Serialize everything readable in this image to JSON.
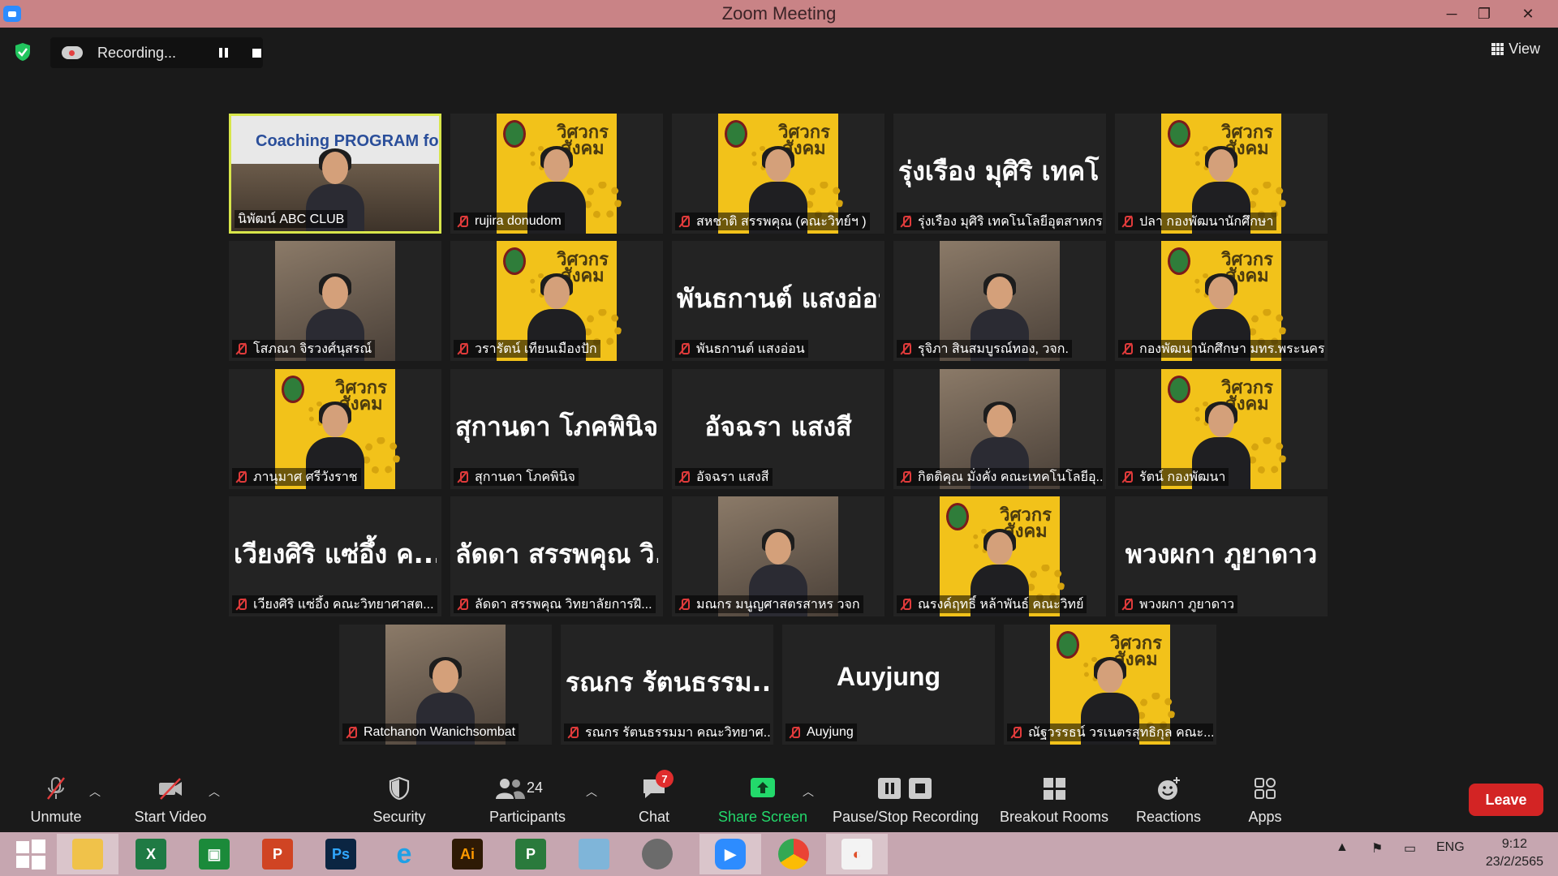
{
  "window": {
    "title": "Zoom Meeting",
    "minimize": "─",
    "restore": "❐",
    "close": "✕"
  },
  "topbar": {
    "recording_label": "Recording...",
    "view_label": "View"
  },
  "tiles": [
    {
      "label": "นิพัฒน์ ABC CLUB",
      "type": "photo",
      "overlay": "Coaching PROGRAM for ..."
    },
    {
      "label": "rujira donudom",
      "type": "poster"
    },
    {
      "label": "สหชาติ สรรพคุณ (คณะวิทย์ฯ )",
      "type": "poster"
    },
    {
      "label": "รุ่งเรือง มุศิริ เทคโนโลยีอุตสาหกร...",
      "type": "name",
      "big": "รุ่งเรือง มุศิริ เทคโ..."
    },
    {
      "label": "ปลา กองพัฒนานักศึกษา",
      "type": "poster"
    },
    {
      "label": "โสภณา จิรวงศ์นุสรณ์",
      "type": "photo"
    },
    {
      "label": "วรารัตน์ เทียนเมืองปัก",
      "type": "poster"
    },
    {
      "label": "พันธกานต์ แสงอ่อน",
      "type": "name",
      "big": "พันธกานต์ แสงอ่อน"
    },
    {
      "label": "รุจิภา สินสมบูรณ์ทอง, วจก.",
      "type": "photo"
    },
    {
      "label": "กองพัฒนานักศึกษา มทร.พระนคร",
      "type": "poster"
    },
    {
      "label": "ภานุมาศ ศรีวังราช",
      "type": "poster"
    },
    {
      "label": "สุกานดา โภคพินิจ",
      "type": "name",
      "big": "สุกานดา โภคพินิจ"
    },
    {
      "label": "อัจฉรา แสงสี",
      "type": "name",
      "big": "อัจฉรา แสงสี"
    },
    {
      "label": "กิตติคุณ มั่งคั่ง คณะเทคโนโลยีอุ...",
      "type": "photo"
    },
    {
      "label": "รัตน์ กองพัฒนา",
      "type": "poster"
    },
    {
      "label": "เวียงศิริ แซ่อึ้ง คณะวิทยาศาสต...",
      "type": "name",
      "big": "เวียงศิริ แซ่อึ้ง ค..."
    },
    {
      "label": "ลัดดา สรรพคุณ วิทยาลัยการฝึ...",
      "type": "name",
      "big": "ลัดดา สรรพคุณ วิ..."
    },
    {
      "label": "มณกร มนูญศาสตรสาหร วจก",
      "type": "photo"
    },
    {
      "label": "ณรงค์ฤทธิ์ หล้าพันธ์ คณะวิทย์",
      "type": "poster"
    },
    {
      "label": "พวงผกา ภูยาดาว",
      "type": "name",
      "big": "พวงผกา ภูยาดาว"
    },
    {
      "label": "Ratchanon Wanichsombat",
      "type": "photo"
    },
    {
      "label": "รณกร รัตนธรรมมา คณะวิทยาศ...",
      "type": "name",
      "big": "รณกร รัตนธรรม..."
    },
    {
      "label": "Auyjung",
      "type": "name",
      "big": "Auyjung"
    },
    {
      "label": "ณัฐวรรธน์ วรเนตรสุทธิกุล คณะ...",
      "type": "poster"
    }
  ],
  "poster_text": "วิศวกรสังคม",
  "toolbar": {
    "unmute": "Unmute",
    "start_video": "Start Video",
    "security": "Security",
    "participants": "Participants",
    "participants_count": "24",
    "chat": "Chat",
    "chat_badge": "7",
    "share_screen": "Share Screen",
    "pause_stop": "Pause/Stop Recording",
    "breakout": "Breakout Rooms",
    "reactions": "Reactions",
    "apps": "Apps",
    "leave": "Leave"
  },
  "taskbar": {
    "apps": [
      "Windows Start",
      "File Explorer",
      "Excel",
      "Publisher",
      "PowerPoint",
      "Photoshop",
      "Internet Explorer",
      "Illustrator",
      "Project",
      "Notepad",
      "PhotoScape",
      "Zoom",
      "Chrome",
      "Photo Viewer"
    ],
    "lang": "ENG",
    "time": "9:12",
    "date": "23/2/2565"
  },
  "colors": {
    "accent": "#2d8cff",
    "leave": "#d32424",
    "share": "#23d96b",
    "active_border": "#d8e64a",
    "poster": "#f2c21a"
  }
}
